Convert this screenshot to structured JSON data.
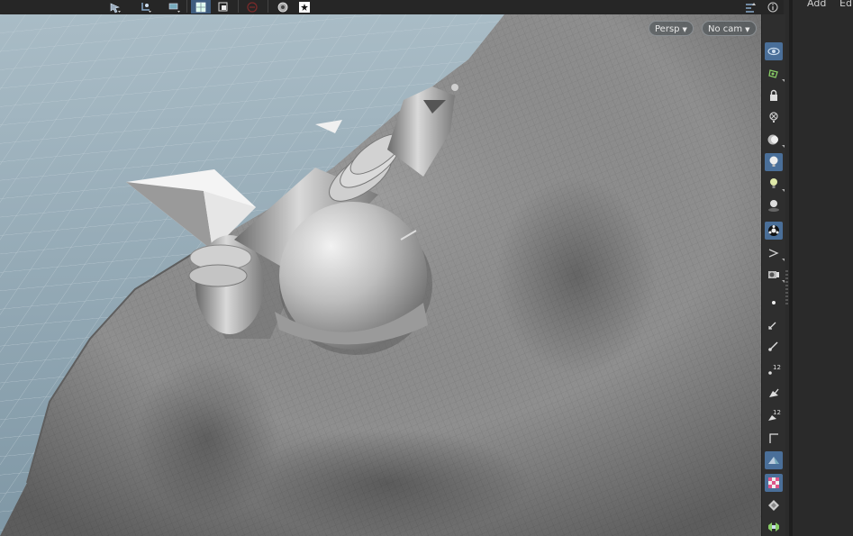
{
  "viewport": {
    "camera_view": "Persp",
    "camera_select": "No cam"
  },
  "right_panel": {
    "menu": [
      "Add",
      "Ed"
    ]
  },
  "toolbar_right": {
    "badge_1": "12",
    "badge_2": "12"
  },
  "colors": {
    "active": "#4a6f99",
    "background_grid": "#9fb2bd",
    "cloth": "#8e8e8e"
  }
}
